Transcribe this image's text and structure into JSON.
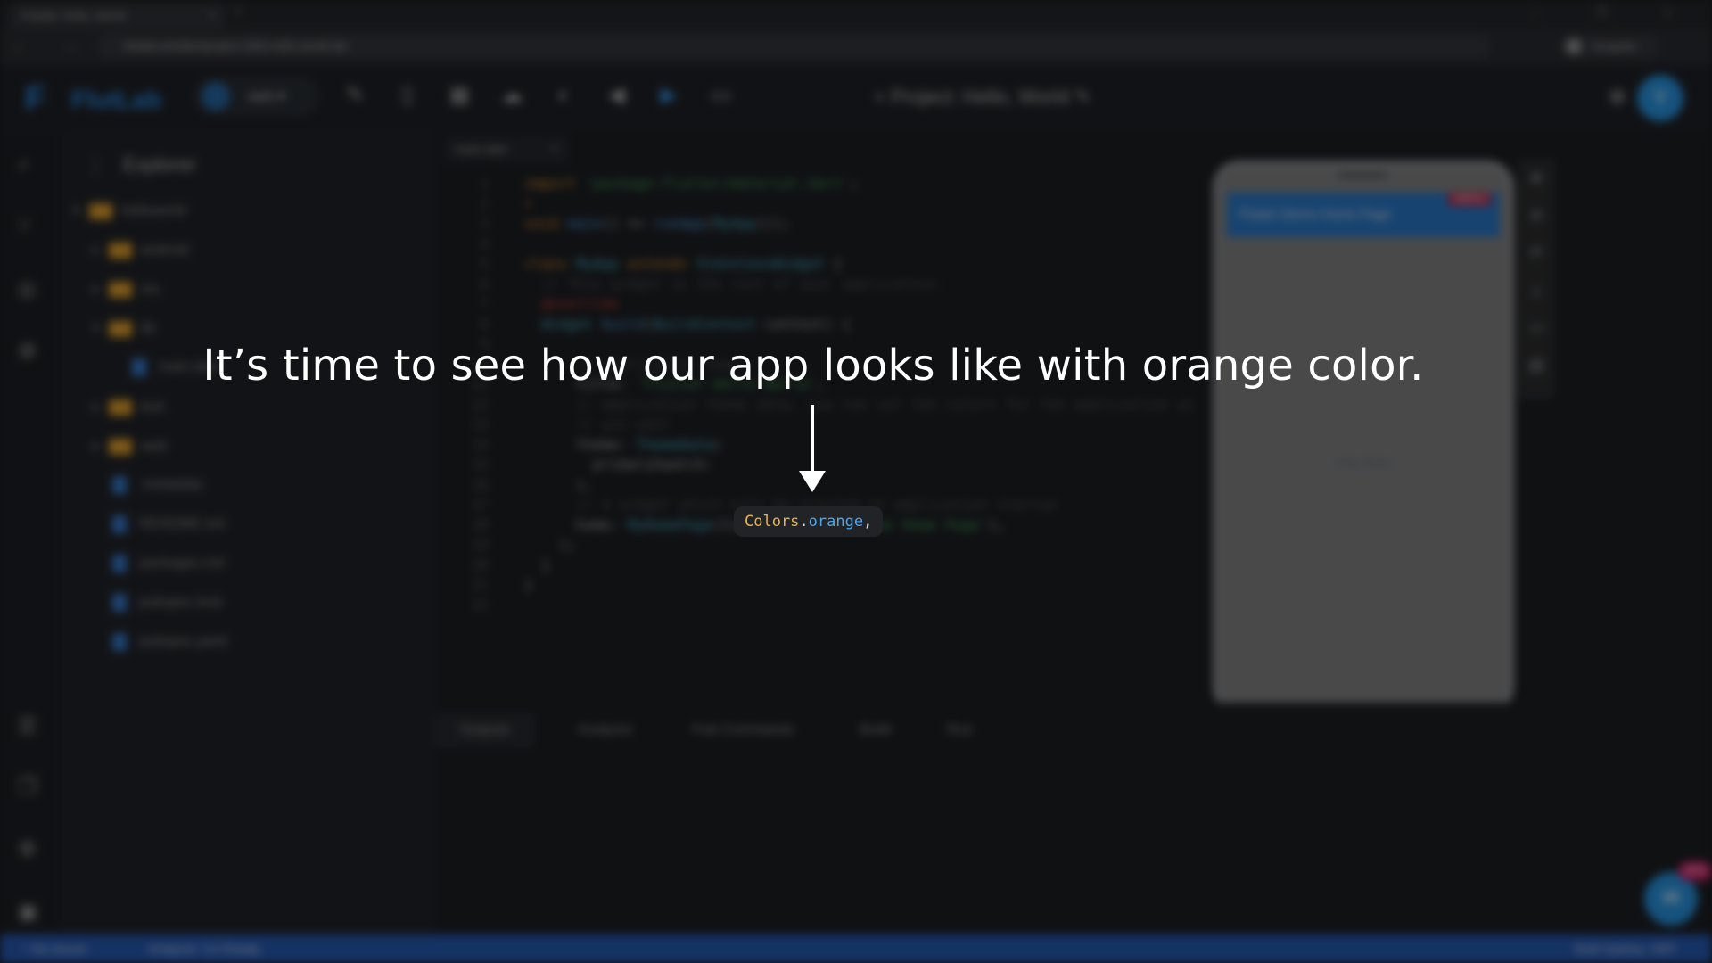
{
  "browser": {
    "tab_title": "Flutlab: Hello, World",
    "tab_close": "×",
    "new_tab": "+",
    "window_controls": "– ❐ ×",
    "nav": "← → ⟳",
    "url": "flutlab.io/editor/project-1581-hello-world-ide",
    "profile": "Incognito"
  },
  "toolbar": {
    "logo_mark": "F",
    "logo_text": "FlutLab",
    "device": "web",
    "device_caret": "▾",
    "icons": [
      "✎",
      "▯",
      "▦",
      "☁",
      "◐",
      "◀",
      "▶",
      "▭"
    ],
    "project_plus": "+",
    "project": "Project: Hello, World",
    "edit_icon": "✎",
    "add_user_icon": "⊕",
    "avatar": "Y"
  },
  "activity": [
    "⌕",
    "⑂",
    "◎",
    "⚙",
    "☰",
    "❐",
    "⚙",
    "▣"
  ],
  "explorer": {
    "title": "Explorer",
    "menu": "⋮",
    "items": [
      {
        "label": "helloworld",
        "type": "folder",
        "chev": "▾"
      },
      {
        "label": "android",
        "type": "folder",
        "chev": "▸"
      },
      {
        "label": "ios",
        "type": "folder",
        "chev": "▸"
      },
      {
        "label": "lib",
        "type": "folder",
        "chev": "▾"
      },
      {
        "label": "main.dart",
        "type": "file",
        "chev": ""
      },
      {
        "label": "test",
        "type": "folder",
        "chev": "▸"
      },
      {
        "label": "web",
        "type": "folder",
        "chev": "▸"
      },
      {
        "label": ".metadata",
        "type": "file",
        "chev": ""
      },
      {
        "label": "README.md",
        "type": "file",
        "chev": ""
      },
      {
        "label": "packages.md",
        "type": "file",
        "chev": ""
      },
      {
        "label": "pubspec.lock",
        "type": "file",
        "chev": ""
      },
      {
        "label": "pubspec.yaml",
        "type": "file",
        "chev": ""
      }
    ]
  },
  "editor": {
    "tab": "main.dart",
    "tab_close": "×",
    "lines": [
      {
        "n": "1",
        "parts": [
          [
            "kw",
            "import "
          ],
          [
            "str",
            "'package:flutter/material.dart'"
          ],
          [
            "pl",
            ";"
          ]
        ]
      },
      {
        "n": "2",
        "parts": [
          [
            "kw",
            "•"
          ]
        ]
      },
      {
        "n": "3",
        "parts": [
          [
            "kw",
            "void "
          ],
          [
            "fn",
            "main"
          ],
          [
            "pl",
            "() => "
          ],
          [
            "fn",
            "runApp"
          ],
          [
            "pl",
            "("
          ],
          [
            "cls",
            "MyApp"
          ],
          [
            "pl",
            "());"
          ]
        ]
      },
      {
        "n": "4",
        "parts": []
      },
      {
        "n": "5",
        "parts": [
          [
            "kw",
            "class "
          ],
          [
            "cls",
            "MyApp "
          ],
          [
            "kw",
            "extends "
          ],
          [
            "cls",
            "StatelessWidget "
          ],
          [
            "pl",
            "{"
          ]
        ]
      },
      {
        "n": "6",
        "parts": [
          [
            "cmt",
            "  // This widget is the root of your application."
          ]
        ]
      },
      {
        "n": "7",
        "parts": [
          [
            "ann",
            "  @override"
          ]
        ]
      },
      {
        "n": "8",
        "parts": [
          [
            "cls",
            "  Widget "
          ],
          [
            "fn",
            "build"
          ],
          [
            "pl",
            "("
          ],
          [
            "cls",
            "BuildContext "
          ],
          [
            "pl",
            "context) {"
          ]
        ]
      },
      {
        "n": "9",
        "parts": []
      },
      {
        "n": "10",
        "parts": [
          [
            "cmt",
            "      // application name"
          ]
        ]
      },
      {
        "n": "11",
        "parts": [
          [
            "pl",
            "      title: "
          ],
          [
            "str",
            "'Flutter Hello World'"
          ],
          [
            "pl",
            ","
          ]
        ]
      },
      {
        "n": "12",
        "parts": [
          [
            "cmt",
            "      // application theme data, you can set the colors for the application as"
          ]
        ]
      },
      {
        "n": "13",
        "parts": [
          [
            "cmt",
            "      // you want"
          ]
        ]
      },
      {
        "n": "14",
        "parts": [
          [
            "pl",
            "      theme: "
          ],
          [
            "cls",
            "ThemeData"
          ],
          [
            "pl",
            "("
          ]
        ]
      },
      {
        "n": "15",
        "parts": [
          [
            "pl",
            "        primarySwatch: "
          ]
        ]
      },
      {
        "n": "16",
        "parts": [
          [
            "pl",
            "      ),"
          ]
        ]
      },
      {
        "n": "17",
        "parts": [
          [
            "cmt",
            "      // A widget which will be started on application startup"
          ]
        ]
      },
      {
        "n": "18",
        "parts": [
          [
            "pl",
            "      home: "
          ],
          [
            "cls",
            "MyHomePage"
          ],
          [
            "pl",
            "(title: "
          ],
          [
            "str",
            "'Flutter Demo Home Page'"
          ],
          [
            "pl",
            "),"
          ]
        ]
      },
      {
        "n": "19",
        "parts": [
          [
            "pl",
            "    );"
          ]
        ]
      },
      {
        "n": "20",
        "parts": [
          [
            "pl",
            "  }"
          ]
        ]
      },
      {
        "n": "21",
        "parts": [
          [
            "pl",
            "}"
          ]
        ]
      },
      {
        "n": "22",
        "parts": []
      }
    ]
  },
  "preview": {
    "appbar_title": "Flutter Demo Home Page",
    "debug_banner": "DEBUG",
    "body_text": "Hello World",
    "tools": [
      "⊕",
      "⊖",
      "⟳",
      "⤓",
      "▭",
      "▤"
    ]
  },
  "bottom_tabs": [
    "Outputs",
    "Analyzer",
    "Pub Commands",
    "Build",
    "Run"
  ],
  "fab": {
    "icon": "✉",
    "badge": "NEW"
  },
  "status": {
    "left": "⑂ No issues",
    "middle": "Analyzer: 3.0 Ready",
    "right": "Built Sydney: DEF"
  },
  "overlay": {
    "caption": "It’s time to see how our app looks like with orange color.",
    "code_class": "Colors",
    "code_dot": ".",
    "code_member": "orange",
    "code_comma": ","
  },
  "colors": {
    "chip_class": "#e8b44a",
    "chip_member": "#4ea6ec",
    "status_bar": "#1c4fa8",
    "accent": "#1d8ad6"
  }
}
